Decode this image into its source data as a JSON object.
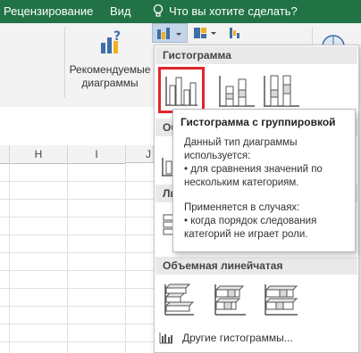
{
  "ribbon_tabs": [
    "Рецензирование",
    "Вид"
  ],
  "tell_me": {
    "placeholder": "Что вы хотите сделать?"
  },
  "ribbon": {
    "recommended_charts_line1": "Рекомендуемые",
    "recommended_charts_line2": "диаграммы"
  },
  "columns": [
    "H",
    "I",
    "J"
  ],
  "dropdown": {
    "section_column": "Гистограмма",
    "section_3d_column_partial": "Об",
    "section_bar_partial": "Ли",
    "section_3d_bar": "Объемная линейчатая",
    "more_link": "Другие гистограммы..."
  },
  "tooltip": {
    "title": "Гистограмма с группировкой",
    "line1": "Данный тип диаграммы",
    "line2": "используется:",
    "line3": "• для сравнения значений по",
    "line4": "нескольким категориям.",
    "line5": "Применяется в случаях:",
    "line6": "• когда порядок следования",
    "line7": "категорий не играет роли."
  },
  "colors": {
    "accent_green": "#217346",
    "highlight_red": "#e0262b"
  }
}
